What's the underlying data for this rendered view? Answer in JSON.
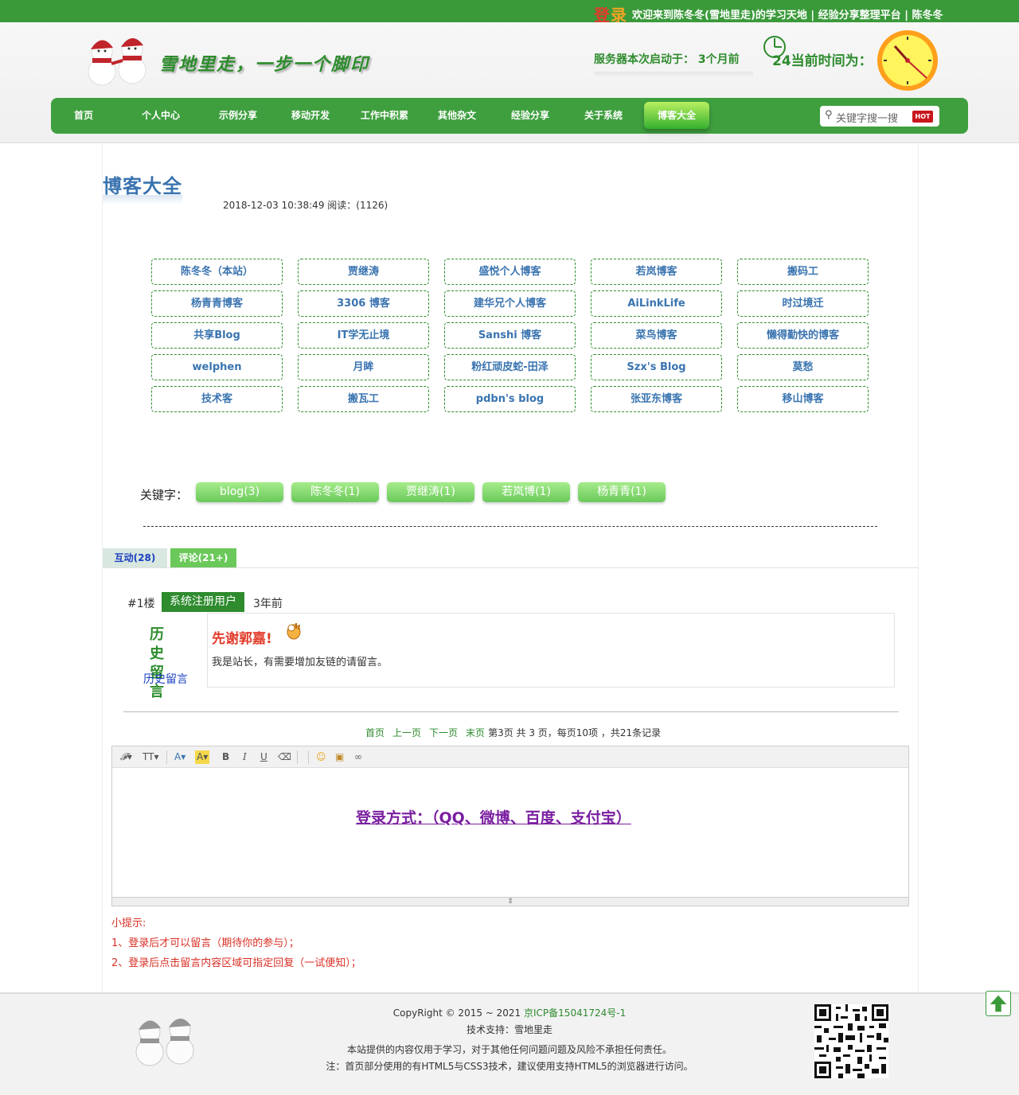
{
  "topbar": {
    "login_main": "登",
    "login_rest": "录",
    "welcome": "欢迎来到陈冬冬(雪地里走)的学习天地 | 经验分享整理平台 | 陈冬冬"
  },
  "header": {
    "slogan": "雪地里走，一步一个脚印",
    "server_start": "服务器本次启动于：  3个月前",
    "time_label": "24当前时间为："
  },
  "nav": {
    "items": [
      "首页",
      "个人中心",
      "示例分享",
      "移动开发",
      "工作中积累",
      "其他杂文",
      "经验分享",
      "关于系统",
      "博客大全"
    ],
    "active": "博客大全",
    "search_placeholder": "关键字搜一搜",
    "hot_badge": "HOT"
  },
  "article": {
    "title": "博客大全",
    "meta": "2018-12-03 10:38:49 阅读：(1126)"
  },
  "blogs": [
    "陈冬冬（本站）",
    "贾继涛",
    "盛悦个人博客",
    "若岚博客",
    "搬码工",
    "杨青青博客",
    "3306 博客",
    "建华兄个人博客",
    "AiLinkLife",
    "时过境迁",
    "共享Blog",
    "IT学无止境",
    "Sanshi 博客",
    "菜鸟博客",
    "懒得勤快的博客",
    "welphen",
    "月眸",
    "粉红顽皮蛇-田泽",
    "Szx's Blog",
    "莫愁",
    "技术客",
    "搬瓦工",
    "pdbn's blog",
    "张亚东博客",
    "移山博客"
  ],
  "keywords": {
    "label": "关键字：",
    "tags": [
      "blog(3)",
      "陈冬冬(1)",
      "贾继涛(1)",
      "若岚博(1)",
      "杨青青(1)"
    ]
  },
  "tabs": {
    "interact": "互动(28)",
    "comments": "评论(21+)"
  },
  "comment": {
    "floor": "#1楼",
    "user": "系统注册用户",
    "time": "3年前",
    "avatar_text": "历史留言",
    "history_link": "历史留言",
    "thanks": "先谢郭嘉!",
    "body": "我是站长，有需要增加友链的请留言。"
  },
  "pager": {
    "first": "首页",
    "prev": "上一页",
    "next": "下一页",
    "last": "末页",
    "info": "第3页 共 3 页，每页10项 ，共21条记录"
  },
  "editor": {
    "login_methods": "登录方式：（QQ、微博、百度、支付宝）"
  },
  "tips": {
    "title": "小提示:",
    "line1": "1、登录后才可以留言（期待你的参与）；",
    "line2": "2、登录后点击留言内容区域可指定回复（一试便知）；"
  },
  "footer": {
    "copyright_prefix": "CopyRight © 2015 ~ 2021 ",
    "icp": "京ICP备15041724号-1",
    "support": "技术支持：雪地里走",
    "disclaimer": "本站提供的内容仅用于学习，对于其他任何问题问题及风险不承担任何责任。",
    "note": "注：首页部分使用的有HTML5与CSS3技术，建议使用支持HTML5的浏览器进行访问。"
  },
  "colors": {
    "brand_green": "#3a9a3a",
    "link_blue": "#3a74b0",
    "alert_red": "#d93025"
  }
}
